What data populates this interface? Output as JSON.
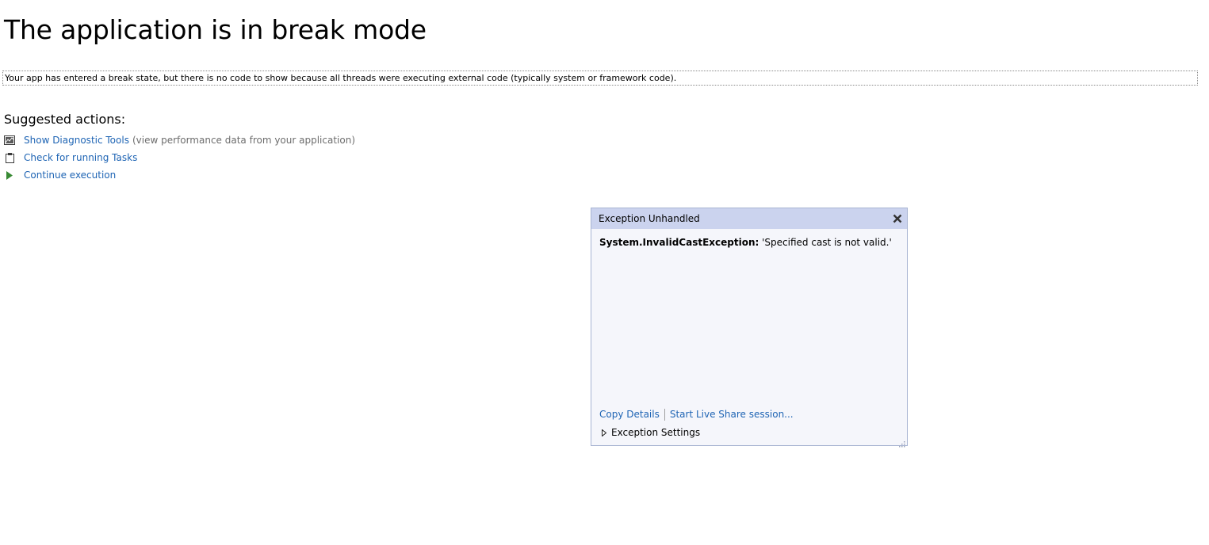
{
  "page": {
    "title": "The application is in break mode",
    "message": "Your app has entered a break state, but there is no code to show because all threads were executing external code (typically system or framework code).",
    "suggested_heading": "Suggested actions:",
    "actions": [
      {
        "label": "Show Diagnostic Tools",
        "hint": "(view performance data from your application)",
        "icon": "diagnostic-tools-icon"
      },
      {
        "label": "Check for running Tasks",
        "hint": "",
        "icon": "clipboard-icon"
      },
      {
        "label": "Continue execution",
        "hint": "",
        "icon": "play-icon"
      }
    ]
  },
  "popup": {
    "title": "Exception Unhandled",
    "close_icon": "close-icon",
    "exception_type": "System.InvalidCastException:",
    "exception_message": "'Specified cast is not valid.'",
    "copy_details": "Copy Details",
    "live_share": "Start Live Share session...",
    "settings_label": "Exception Settings"
  },
  "colors": {
    "link": "#1e64b4",
    "popup_header": "#cbd3ee",
    "popup_body": "#f5f6fb",
    "play_green": "#388a34"
  }
}
